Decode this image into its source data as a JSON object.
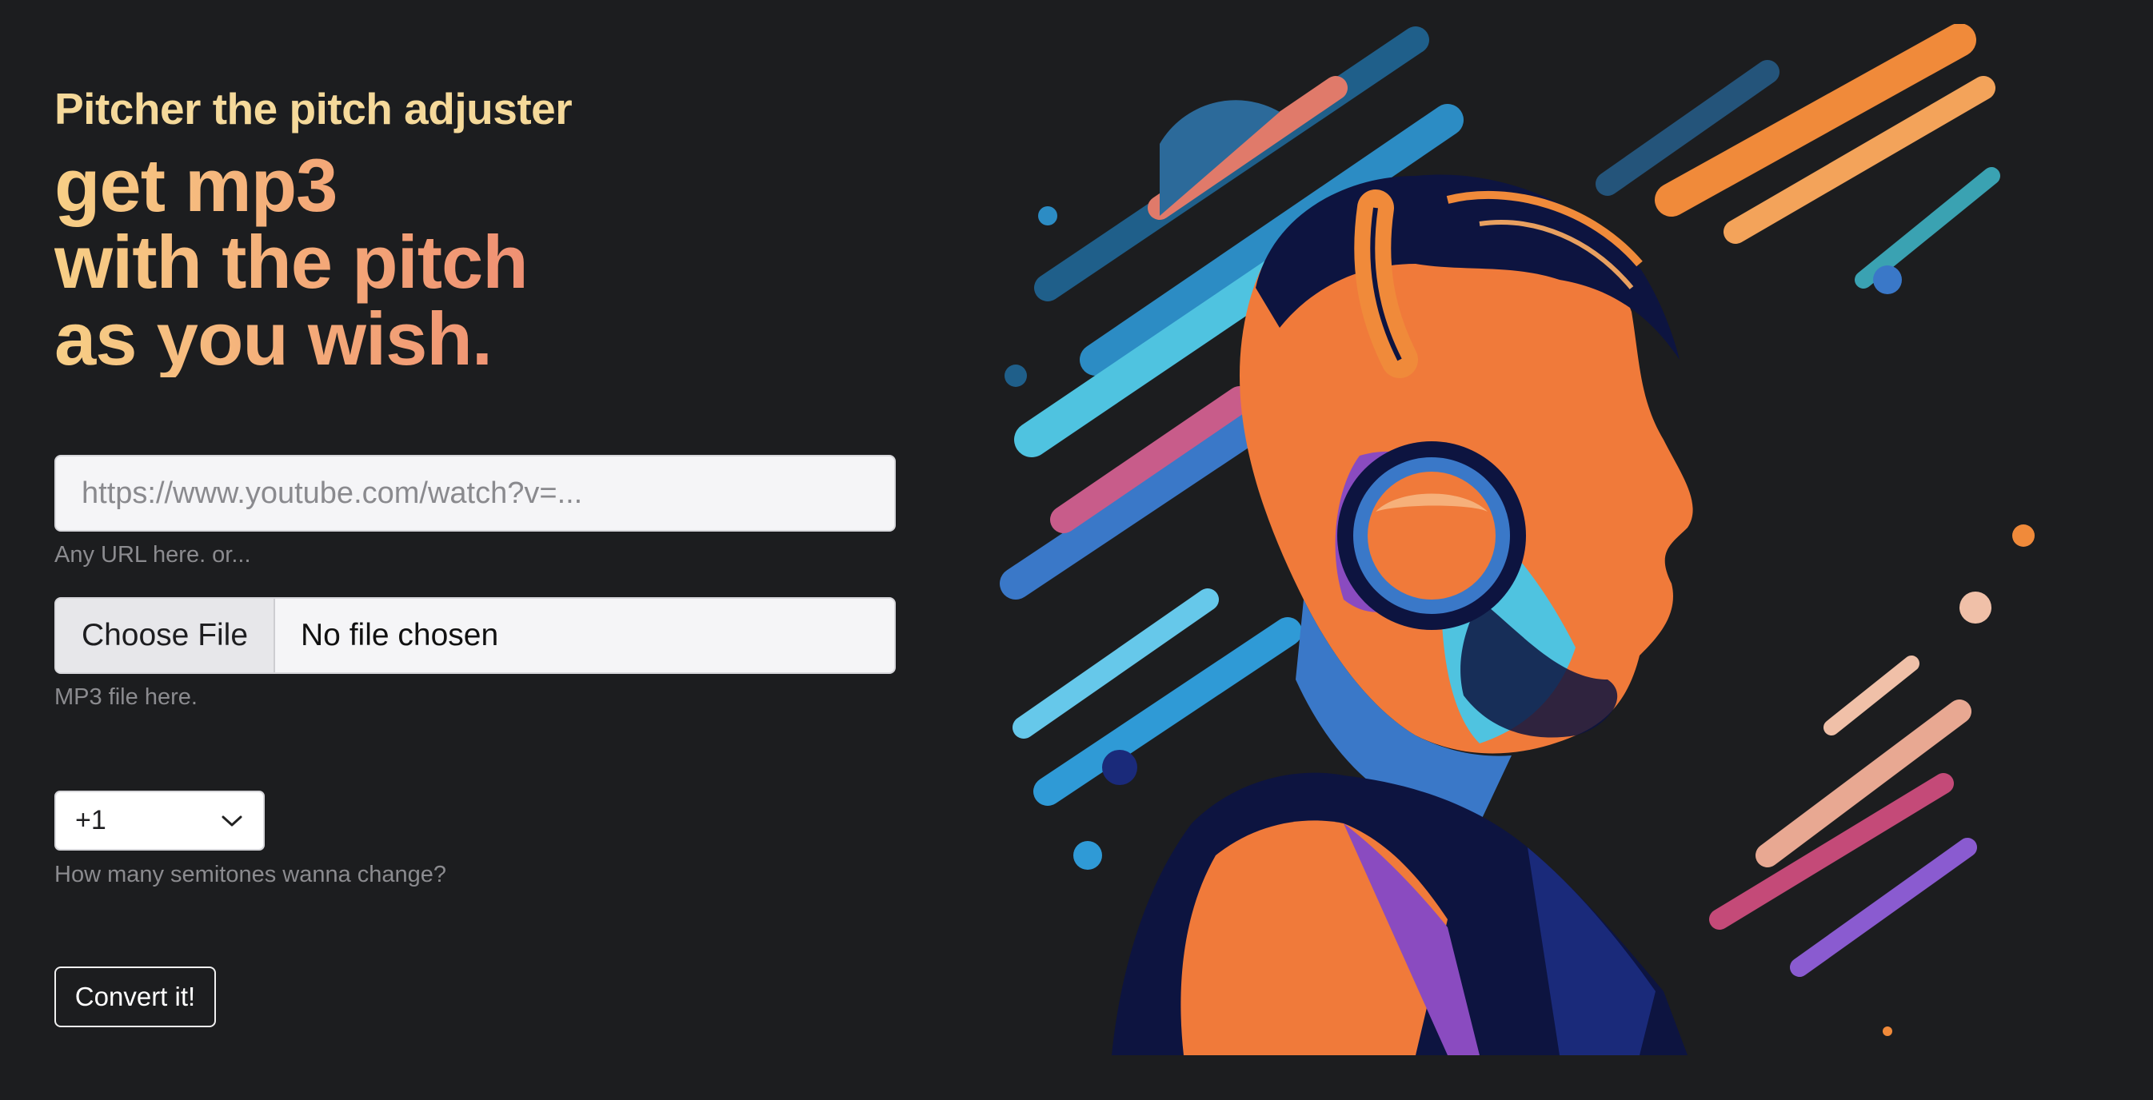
{
  "header": {
    "subtitle": "Pitcher the pitch adjuster",
    "headline_line1": "get mp3",
    "headline_line2": "with the pitch",
    "headline_line3": "as you wish."
  },
  "form": {
    "url_placeholder": "https://www.youtube.com/watch?v=...",
    "url_help": "Any URL here. or...",
    "file_button_label": "Choose File",
    "file_status": "No file chosen",
    "file_help": "MP3 file here.",
    "semitone_selected": "+1",
    "semitone_help": "How many semitones wanna change?",
    "convert_label": "Convert it!"
  },
  "illustration": {
    "icon": "person-with-headphones-illustration"
  },
  "colors": {
    "background": "#1c1d1f",
    "subtitle": "#f5d99a",
    "headline_start": "#f7cf86",
    "headline_end": "#ef9073"
  }
}
